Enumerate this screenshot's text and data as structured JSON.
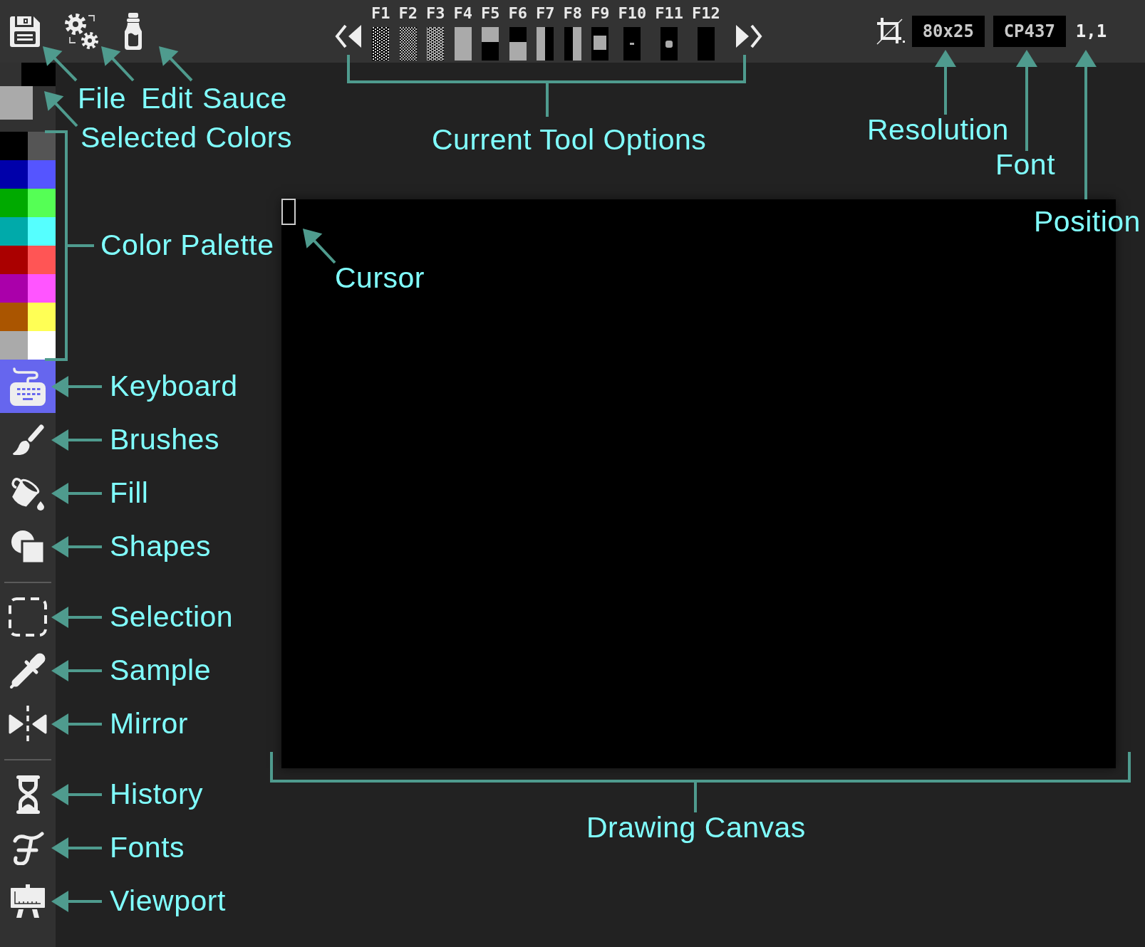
{
  "toolbar": {
    "menus": [
      {
        "kind": "floppy",
        "callout": "File"
      },
      {
        "kind": "gears",
        "callout": "Edit"
      },
      {
        "kind": "bottle",
        "callout": "Sauce"
      }
    ],
    "tool_options": {
      "callout": "Current Tool Options",
      "keys": [
        {
          "label": "F1",
          "kind": "light_shade"
        },
        {
          "label": "F2",
          "kind": "medium_shade"
        },
        {
          "label": "F3",
          "kind": "dark_shade"
        },
        {
          "label": "F4",
          "kind": "full_block"
        },
        {
          "label": "F5",
          "kind": "upper_half"
        },
        {
          "label": "F6",
          "kind": "lower_half"
        },
        {
          "label": "F7",
          "kind": "left_half"
        },
        {
          "label": "F8",
          "kind": "right_half"
        },
        {
          "label": "F9",
          "kind": "small_square"
        },
        {
          "label": "F10",
          "kind": "middle_dot"
        },
        {
          "label": "F11",
          "kind": "bullet"
        },
        {
          "label": "F12",
          "kind": "blank"
        }
      ]
    },
    "status": {
      "resolution": {
        "value": "80x25",
        "callout": "Resolution"
      },
      "font": {
        "value": "CP437",
        "callout": "Font"
      },
      "position": {
        "value": "1,1",
        "callout": "Position"
      }
    }
  },
  "sidebar": {
    "selected_colors": {
      "callout": "Selected Colors",
      "swatches": [
        {
          "kind": "foreground",
          "color": "#000000"
        },
        {
          "kind": "background",
          "color": "#aaaaaa"
        }
      ]
    },
    "palette": {
      "callout": "Color Palette",
      "colors": [
        {
          "color": "#000000"
        },
        {
          "color": "#555555"
        },
        {
          "color": "#0000aa"
        },
        {
          "color": "#5555ff"
        },
        {
          "color": "#00aa00"
        },
        {
          "color": "#55ff55"
        },
        {
          "color": "#00aaaa"
        },
        {
          "color": "#55ffff"
        },
        {
          "color": "#aa0000"
        },
        {
          "color": "#ff5555"
        },
        {
          "color": "#aa00aa"
        },
        {
          "color": "#ff55ff"
        },
        {
          "color": "#aa5500"
        },
        {
          "color": "#ffff55"
        },
        {
          "color": "#aaaaaa"
        },
        {
          "color": "#ffffff"
        }
      ]
    },
    "tool_groups": [
      {
        "tools": [
          {
            "kind": "keyboard",
            "callout": "Keyboard",
            "selected": true
          },
          {
            "kind": "brush",
            "callout": "Brushes",
            "selected": false
          },
          {
            "kind": "bucket",
            "callout": "Fill",
            "selected": false
          },
          {
            "kind": "shapes",
            "callout": "Shapes",
            "selected": false
          }
        ]
      },
      {
        "tools": [
          {
            "kind": "marquee",
            "callout": "Selection",
            "selected": false
          },
          {
            "kind": "dropper",
            "callout": "Sample",
            "selected": false
          },
          {
            "kind": "mirror",
            "callout": "Mirror",
            "selected": false
          }
        ]
      },
      {
        "tools": [
          {
            "kind": "hourglass",
            "callout": "History",
            "selected": false
          },
          {
            "kind": "script_f",
            "callout": "Fonts",
            "selected": false
          },
          {
            "kind": "easel",
            "callout": "Viewport",
            "selected": false
          }
        ]
      }
    ]
  },
  "canvas": {
    "callout": "Drawing Canvas",
    "cursor_callout": "Cursor"
  }
}
